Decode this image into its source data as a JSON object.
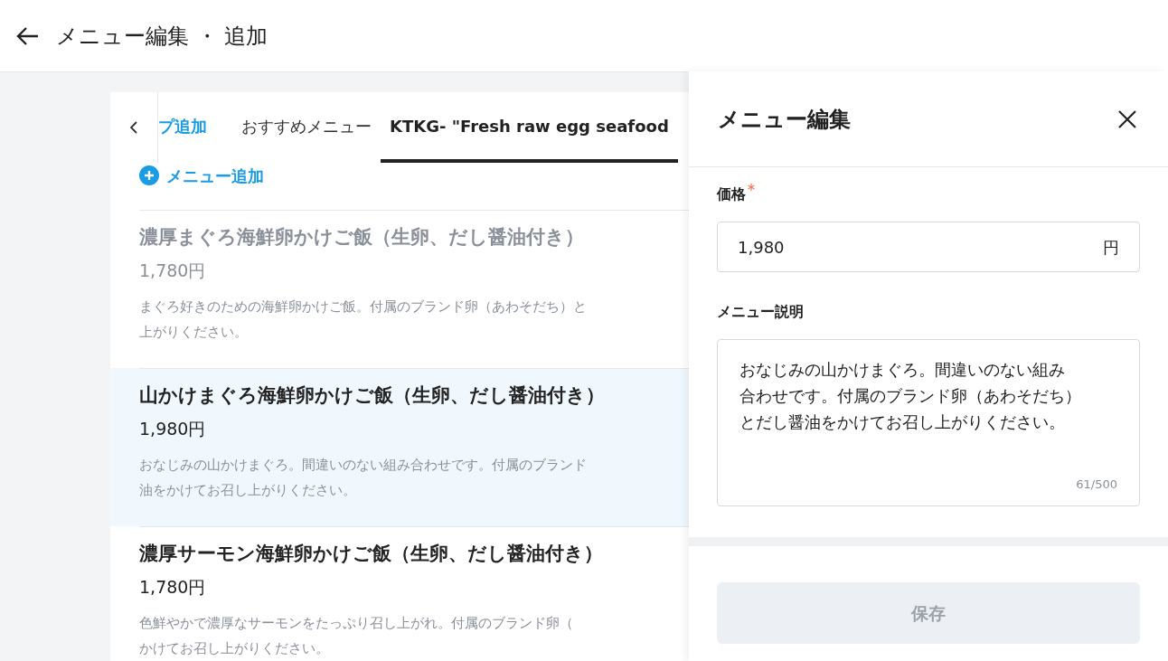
{
  "header": {
    "title": "メニュー編集 ・ 追加"
  },
  "tabs": [
    {
      "label": "プ追加",
      "kind": "action",
      "selected": false
    },
    {
      "label": "おすすめメニュー",
      "kind": "tab",
      "selected": false
    },
    {
      "label": "KTKG- \"Fresh raw egg seafood",
      "kind": "tab",
      "selected": true
    }
  ],
  "add_menu": {
    "label": "メニュー追加"
  },
  "menu_items": [
    {
      "name": "濃厚まぐろ海鮮卵かけご飯（生卵、だし醤油付き）",
      "price": "1,780円",
      "description_lines": [
        "まぐろ好きのための海鮮卵かけご飯。付属のブランド卵（あわそだち）と",
        "上がりください。"
      ],
      "disabled": true,
      "selected": false
    },
    {
      "name": "山かけまぐろ海鮮卵かけご飯（生卵、だし醤油付き）",
      "price": "1,980円",
      "description_lines": [
        "おなじみの山かけまぐろ。間違いのない組み合わせです。付属のブランド",
        "油をかけてお召し上がりください。"
      ],
      "disabled": false,
      "selected": true
    },
    {
      "name": "濃厚サーモン海鮮卵かけご飯（生卵、だし醤油付き）",
      "price": "1,780円",
      "description_lines": [
        "色鮮やかで濃厚なサーモンをたっぷり召し上がれ。付属のブランド卵（",
        "かけてお召し上がりください。"
      ],
      "disabled": false,
      "selected": false
    }
  ],
  "edit_panel": {
    "title": "メニュー編集",
    "price": {
      "label": "価格",
      "required": true,
      "value": "1,980",
      "unit": "円"
    },
    "description": {
      "label": "メニュー説明",
      "value_lines": [
        "おなじみの山かけまぐろ。間違いのない組み",
        "合わせです。付属のブランド卵（あわそだち）",
        "とだし醤油をかけてお召し上がりください。"
      ],
      "counter": "61/500"
    },
    "save_button": {
      "label": "保存",
      "disabled": true
    }
  }
}
